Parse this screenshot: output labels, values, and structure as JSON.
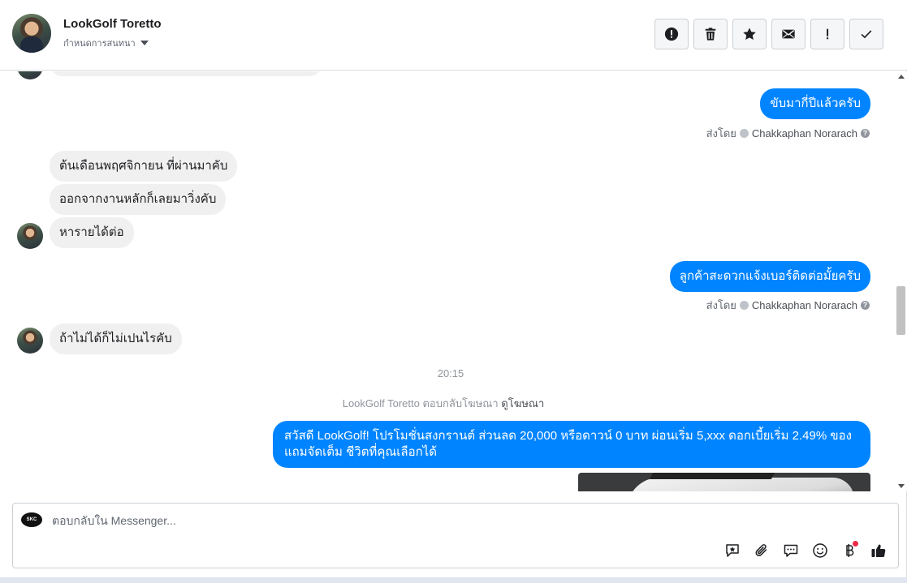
{
  "header": {
    "contact_name": "LookGolf Toretto",
    "subtitle": "กำหนดการสนทนา",
    "actions": [
      {
        "icon": "alert-circle-icon",
        "name": "mark-spam-button"
      },
      {
        "icon": "trash-icon",
        "name": "delete-button"
      },
      {
        "icon": "star-icon",
        "name": "star-button"
      },
      {
        "icon": "envelope-icon",
        "name": "mark-unread-button"
      },
      {
        "icon": "exclamation-icon",
        "name": "follow-up-button"
      },
      {
        "icon": "check-icon",
        "name": "mark-done-button"
      }
    ]
  },
  "messages": {
    "out_1": "ขับมากี่ปีแล้วครับ",
    "in_1": "ต้นเดือนพฤศจิกายน ที่ผ่านมาคับ",
    "in_2": "ออกจากงานหลักก็เลยมาวิ่งคับ",
    "in_3": "หารายได้ต่อ",
    "out_2": "ลูกค้าสะดวกแจ้งเบอร์ติดต่อมั้ยครับ",
    "in_4": "ถ้าไม่ได้ก็ไม่เปนไรคับ",
    "ad_message": "สวัสดี LookGolf! โปรโมชั่นสงกรานต์ ส่วนลด 20,000 หรือดาวน์ 0 บาท ผ่อนเริ่ม 5,xxx ดอกเบี้ยเริ่ม 2.49% ของแถมจัดเต็ม ชีวิตที่คุณเลือกได้"
  },
  "sent_by": {
    "prefix": "ส่งโดย",
    "agent": "Chakkaphan Norarach",
    "help": "?"
  },
  "timestamp": "20:15",
  "ad_reply": {
    "text": "LookGolf Toretto ตอบกลับโฆษณา",
    "link": "ดูโฆษณา"
  },
  "composer": {
    "placeholder": "ตอบกลับใน Messenger...",
    "page_logo_text": "SKC",
    "tools": [
      "saved-reply-icon",
      "attachment-icon",
      "chat-bubbles-icon",
      "emoji-icon",
      "baht-payment-icon",
      "thumbs-up-icon"
    ]
  },
  "colors": {
    "outgoing_bubble": "#0084ff",
    "incoming_bubble": "#f1f0f0",
    "notification_dot": "#f02849"
  }
}
